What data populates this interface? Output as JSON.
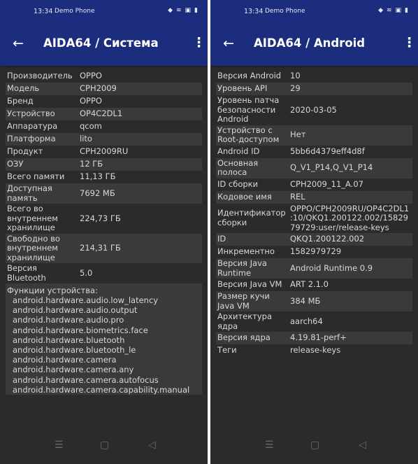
{
  "left": {
    "status": {
      "time": "13:34",
      "carrier": "Demo Phone",
      "icons": [
        "signal-icon",
        "wifi-icon",
        "sim-icon",
        "battery-icon"
      ]
    },
    "appbar": {
      "back": "←",
      "title": "AIDA64  /  Система",
      "menu": "⋮"
    },
    "rows": [
      {
        "k": "Производитель",
        "v": "OPPO"
      },
      {
        "k": "Модель",
        "v": "CPH2009"
      },
      {
        "k": "Бренд",
        "v": "OPPO"
      },
      {
        "k": "Устройство",
        "v": "OP4C2DL1"
      },
      {
        "k": "Аппаратура",
        "v": "qcom"
      },
      {
        "k": "Платформа",
        "v": "lito"
      },
      {
        "k": "Продукт",
        "v": "CPH2009RU"
      },
      {
        "k": "ОЗУ",
        "v": "12 ГБ"
      },
      {
        "k": "Всего памяти",
        "v": "11,13 ГБ"
      },
      {
        "k": "Доступная память",
        "v": "7692 МБ"
      },
      {
        "k": "Всего во внутреннем хранилище",
        "v": "224,73 ГБ"
      },
      {
        "k": "Свободно во внутреннем хранилище",
        "v": "214,31 ГБ"
      },
      {
        "k": "Версия Bluetooth",
        "v": "5.0"
      }
    ],
    "features_label": "Функции устройства:",
    "features": [
      "android.hardware.audio.low_latency",
      "android.hardware.audio.output",
      "android.hardware.audio.pro",
      "android.hardware.biometrics.face",
      "android.hardware.bluetooth",
      "android.hardware.bluetooth_le",
      "android.hardware.camera",
      "android.hardware.camera.any",
      "android.hardware.camera.autofocus",
      "android.hardware.camera.capability.manual"
    ]
  },
  "right": {
    "status": {
      "time": "13:34",
      "carrier": "Demo Phone",
      "icons": [
        "signal-icon",
        "wifi-icon",
        "sim-icon",
        "battery-icon"
      ]
    },
    "appbar": {
      "back": "←",
      "title": "AIDA64  /  Android",
      "menu": "⋮"
    },
    "rows": [
      {
        "k": "Версия Android",
        "v": "10"
      },
      {
        "k": "Уровень API",
        "v": "29"
      },
      {
        "k": "Уровень патча безопасности Android",
        "v": "2020-03-05"
      },
      {
        "k": "Устройство с Root-доступом",
        "v": "Нет"
      },
      {
        "k": "Android ID",
        "v": "5bb6d4379eff4d8f"
      },
      {
        "k": "Основная полоса",
        "v": "Q_V1_P14,Q_V1_P14"
      },
      {
        "k": "ID сборки",
        "v": "CPH2009_11_A.07"
      },
      {
        "k": "Кодовое имя",
        "v": "REL"
      },
      {
        "k": "Идентификатор сборки",
        "v": "OPPO/CPH2009RU/OP4C2DL1:10/QKQ1.200122.002/1582979729:user/release-keys"
      },
      {
        "k": "ID",
        "v": "QKQ1.200122.002"
      },
      {
        "k": "Инкрементно",
        "v": "1582979729"
      },
      {
        "k": "Версия Java Runtime",
        "v": "Android Runtime 0.9"
      },
      {
        "k": "Версия Java VM",
        "v": "ART 2.1.0"
      },
      {
        "k": "Размер кучи Java VM",
        "v": "384 МБ"
      },
      {
        "k": "Архитектура ядра",
        "v": "aarch64"
      },
      {
        "k": "Версия ядра",
        "v": "4.19.81-perf+"
      },
      {
        "k": "Теги",
        "v": "release-keys"
      }
    ]
  },
  "navbar": {
    "menu": "☰",
    "home": "▢",
    "back": "◁"
  },
  "colors": {
    "appbar": "#1d2d7e",
    "background": "#2b2b2b",
    "row_alt": "#3a3a3a",
    "text": "#d8d8d8"
  }
}
